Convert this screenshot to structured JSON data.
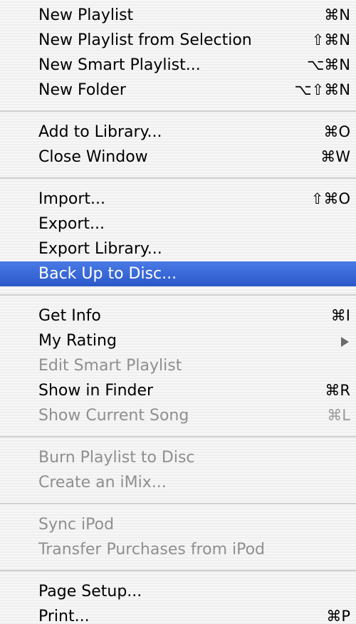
{
  "menu": {
    "group1": [
      {
        "label": "New Playlist",
        "shortcut": "⌘N"
      },
      {
        "label": "New Playlist from Selection",
        "shortcut": "⇧⌘N"
      },
      {
        "label": "New Smart Playlist...",
        "shortcut": "⌥⌘N"
      },
      {
        "label": "New Folder",
        "shortcut": "⌥⇧⌘N"
      }
    ],
    "group2": [
      {
        "label": "Add to Library...",
        "shortcut": "⌘O"
      },
      {
        "label": "Close Window",
        "shortcut": "⌘W"
      }
    ],
    "group3": [
      {
        "label": "Import...",
        "shortcut": "⇧⌘O"
      },
      {
        "label": "Export..."
      },
      {
        "label": "Export Library..."
      },
      {
        "label": "Back Up to Disc...",
        "selected": true
      }
    ],
    "group4": [
      {
        "label": "Get Info",
        "shortcut": "⌘I"
      },
      {
        "label": "My Rating",
        "submenu": "chevron-right-icon"
      },
      {
        "label": "Edit Smart Playlist",
        "disabled": true
      },
      {
        "label": "Show in Finder",
        "shortcut": "⌘R"
      },
      {
        "label": "Show Current Song",
        "shortcut": "⌘L",
        "disabled": true
      }
    ],
    "group5": [
      {
        "label": "Burn Playlist to Disc",
        "disabled": true
      },
      {
        "label": "Create an iMix...",
        "disabled": true
      }
    ],
    "group6": [
      {
        "label": "Sync iPod",
        "disabled": true
      },
      {
        "label": "Transfer Purchases from iPod",
        "disabled": true
      }
    ],
    "group7": [
      {
        "label": "Page Setup..."
      },
      {
        "label": "Print...",
        "shortcut": "⌘P"
      }
    ]
  },
  "colors": {
    "selection": "#2e5fd1",
    "disabled_text": "#8f8f8f",
    "separator": "#cfcfcf"
  }
}
